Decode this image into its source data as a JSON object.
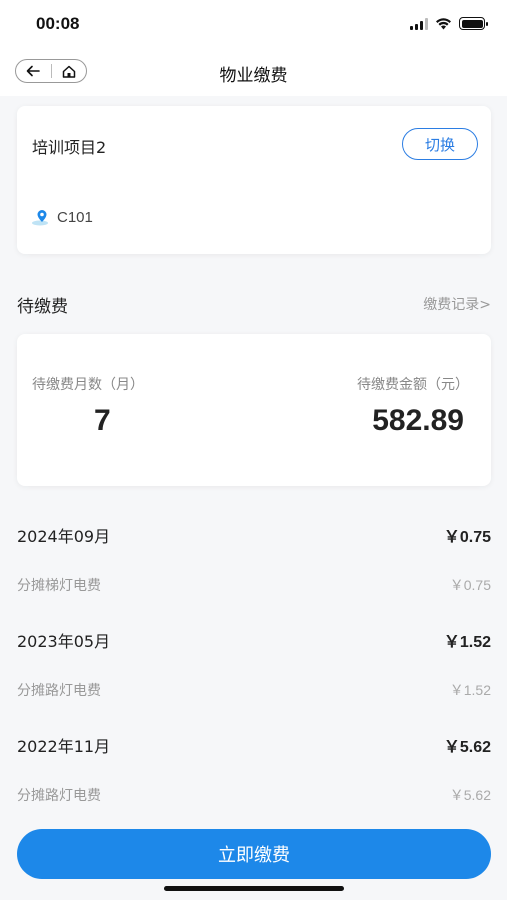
{
  "status": {
    "time": "00:08"
  },
  "nav": {
    "title": "物业缴费"
  },
  "project": {
    "name": "培训项目2",
    "switch_label": "切换",
    "room": "C101"
  },
  "pending": {
    "section_title": "待缴费",
    "record_link": "缴费记录>",
    "months_label": "待缴费月数（月）",
    "months_value": "7",
    "amount_label": "待缴费金额（元）",
    "amount_value": "582.89"
  },
  "bills": [
    {
      "month": "2024年09月",
      "total": "￥0.75",
      "item": "分摊梯灯电费",
      "item_amount": "￥0.75"
    },
    {
      "month": "2023年05月",
      "total": "￥1.52",
      "item": "分摊路灯电费",
      "item_amount": "￥1.52"
    },
    {
      "month": "2022年11月",
      "total": "￥5.62",
      "item": "分摊路灯电费",
      "item_amount": "￥5.62"
    }
  ],
  "pay_button": {
    "label": "立即缴费"
  },
  "colors": {
    "accent": "#1d88e9",
    "outline": "#2b7de3"
  }
}
